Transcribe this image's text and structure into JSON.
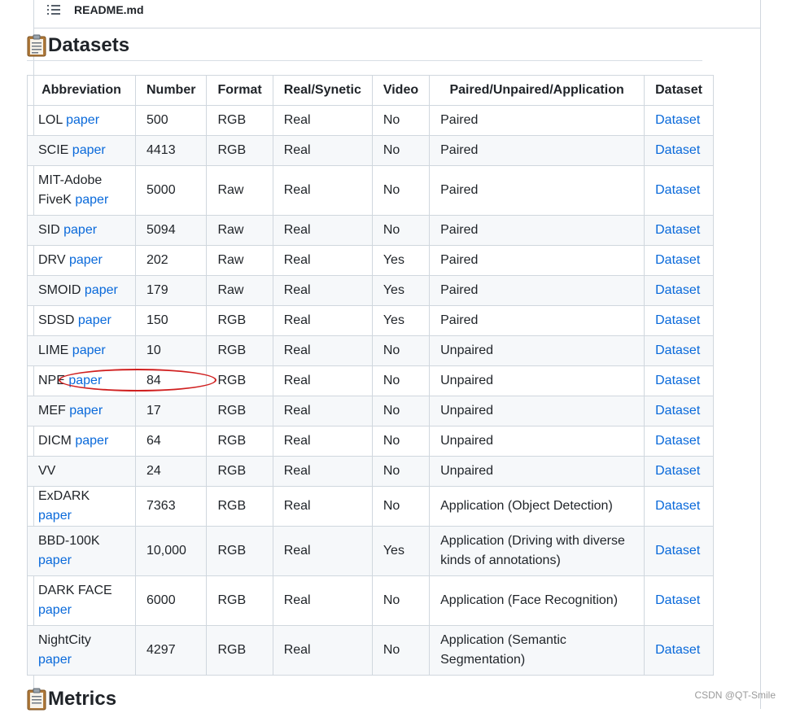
{
  "file_header": {
    "title": "README.md",
    "icon": "list-icon"
  },
  "datasets_heading": {
    "icon": "clipboard-icon",
    "text": "Datasets"
  },
  "metrics_heading": {
    "icon": "clipboard-icon",
    "text": "Metrics"
  },
  "table": {
    "columns": [
      "Abbreviation",
      "Number",
      "Format",
      "Real/Synetic",
      "Video",
      "Paired/Unpaired/Application",
      "Dataset"
    ],
    "rows": [
      {
        "abbr": "LOL",
        "paper": "paper",
        "number": "500",
        "format": "RGB",
        "real": "Real",
        "video": "No",
        "type": "Paired",
        "dataset": "Dataset"
      },
      {
        "abbr": "SCIE",
        "paper": "paper",
        "number": "4413",
        "format": "RGB",
        "real": "Real",
        "video": "No",
        "type": "Paired",
        "dataset": "Dataset"
      },
      {
        "abbr_line1": "MIT-Adobe",
        "abbr_line2": "FiveK",
        "paper": "paper",
        "number": "5000",
        "format": "Raw",
        "real": "Real",
        "video": "No",
        "type": "Paired",
        "dataset": "Dataset"
      },
      {
        "abbr": "SID",
        "paper": "paper",
        "number": "5094",
        "format": "Raw",
        "real": "Real",
        "video": "No",
        "type": "Paired",
        "dataset": "Dataset"
      },
      {
        "abbr": "DRV",
        "paper": "paper",
        "number": "202",
        "format": "Raw",
        "real": "Real",
        "video": "Yes",
        "type": "Paired",
        "dataset": "Dataset"
      },
      {
        "abbr": "SMOID",
        "paper": "paper",
        "number": "179",
        "format": "Raw",
        "real": "Real",
        "video": "Yes",
        "type": "Paired",
        "dataset": "Dataset"
      },
      {
        "abbr": "SDSD",
        "paper": "paper",
        "number": "150",
        "format": "RGB",
        "real": "Real",
        "video": "Yes",
        "type": "Paired",
        "dataset": "Dataset"
      },
      {
        "abbr": "LIME",
        "paper": "paper",
        "number": "10",
        "format": "RGB",
        "real": "Real",
        "video": "No",
        "type": "Unpaired",
        "dataset": "Dataset"
      },
      {
        "abbr": "NPE",
        "paper": "paper",
        "number": "84",
        "format": "RGB",
        "real": "Real",
        "video": "No",
        "type": "Unpaired",
        "dataset": "Dataset"
      },
      {
        "abbr": "MEF",
        "paper": "paper",
        "number": "17",
        "format": "RGB",
        "real": "Real",
        "video": "No",
        "type": "Unpaired",
        "dataset": "Dataset"
      },
      {
        "abbr": "DICM",
        "paper": "paper",
        "number": "64",
        "format": "RGB",
        "real": "Real",
        "video": "No",
        "type": "Unpaired",
        "dataset": "Dataset"
      },
      {
        "abbr": "VV",
        "number": "24",
        "format": "RGB",
        "real": "Real",
        "video": "No",
        "type": "Unpaired",
        "dataset": "Dataset"
      },
      {
        "abbr": "ExDARK",
        "paper": "paper",
        "number": "7363",
        "format": "RGB",
        "real": "Real",
        "video": "No",
        "type": "Application (Object Detection)",
        "dataset": "Dataset"
      },
      {
        "abbr": "BBD-100K",
        "paper": "paper",
        "number": "10,000",
        "format": "RGB",
        "real": "Real",
        "video": "Yes",
        "type_line1": "Application (Driving with diverse",
        "type_line2": "kinds of annotations)",
        "dataset": "Dataset"
      },
      {
        "abbr": "DARK FACE",
        "paper": "paper",
        "number": "6000",
        "format": "RGB",
        "real": "Real",
        "video": "No",
        "type": "Application (Face Recognition)",
        "dataset": "Dataset"
      },
      {
        "abbr": "NightCity",
        "paper": "paper",
        "number": "4297",
        "format": "RGB",
        "real": "Real",
        "video": "No",
        "type_line1": "Application (Semantic",
        "type_line2": "Segmentation)",
        "dataset": "Dataset"
      }
    ]
  },
  "annotation": {
    "target_row": "NPE",
    "color": "#d02020"
  },
  "watermark": "CSDN @QT-Smile",
  "colors": {
    "link": "#0969da",
    "border": "#d0d7de",
    "stripe": "#f6f8fa",
    "text": "#1f2328"
  }
}
